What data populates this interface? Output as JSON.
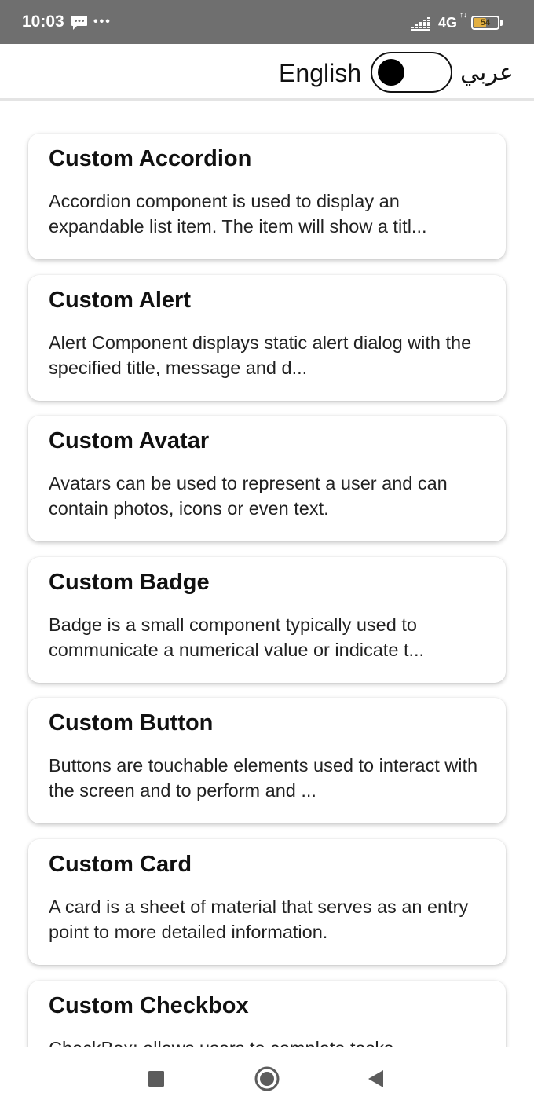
{
  "status_bar": {
    "time": "10:03",
    "more_dots": "•••",
    "network": "4G",
    "network_arrows": "↑↓",
    "battery_percent": "54",
    "battery_level": 0.54,
    "battery_color": "#e3b042",
    "background_color": "#6f6f6f"
  },
  "header": {
    "language_left": "English",
    "language_right": "عربي",
    "switch_on": false
  },
  "cards": [
    {
      "title": "Custom Accordion",
      "description": "Accordion component is used to display an expandable list item. The item will show a titl..."
    },
    {
      "title": "Custom Alert",
      "description": "Alert Component displays static alert dialog with the specified title, message and d..."
    },
    {
      "title": "Custom Avatar",
      "description": "Avatars can be used to represent a user and can contain photos, icons or even text."
    },
    {
      "title": "Custom Badge",
      "description": "Badge is a small component typically used to communicate a numerical value or indicate t..."
    },
    {
      "title": "Custom Button",
      "description": "Buttons are touchable elements used to interact with the screen and to perform and ..."
    },
    {
      "title": "Custom Card",
      "description": "A card is a sheet of material that serves as an entry point to more detailed information."
    },
    {
      "title": "Custom Checkbox",
      "description": "CheckBox: allows users to complete tasks"
    }
  ],
  "nav": {
    "recent_icon": "square-icon",
    "home_icon": "circle-icon",
    "back_icon": "triangle-back-icon"
  }
}
